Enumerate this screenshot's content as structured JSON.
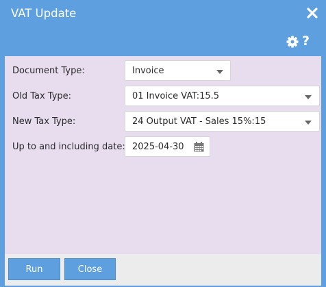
{
  "dialog": {
    "title": "VAT Update",
    "help_label": "?"
  },
  "form": {
    "document_type": {
      "label": "Document Type:",
      "value": "Invoice"
    },
    "old_tax_type": {
      "label": "Old Tax Type:",
      "value": "01 Invoice VAT:15.5"
    },
    "new_tax_type": {
      "label": "New Tax Type:",
      "value": "24 Output VAT - Sales 15%:15"
    },
    "date": {
      "label": "Up to and including date:",
      "value": "2025-04-30"
    }
  },
  "footer": {
    "run_label": "Run",
    "close_label": "Close"
  },
  "icons": {
    "close": "close-icon",
    "settings": "gear-icon",
    "help": "question-icon",
    "dropdown": "chevron-down-icon",
    "calendar": "calendar-icon"
  },
  "colors": {
    "header": "#5d9fdf",
    "content_bg": "#e8dcef",
    "footer_bg": "#ececec",
    "button": "#5d9fdf"
  }
}
